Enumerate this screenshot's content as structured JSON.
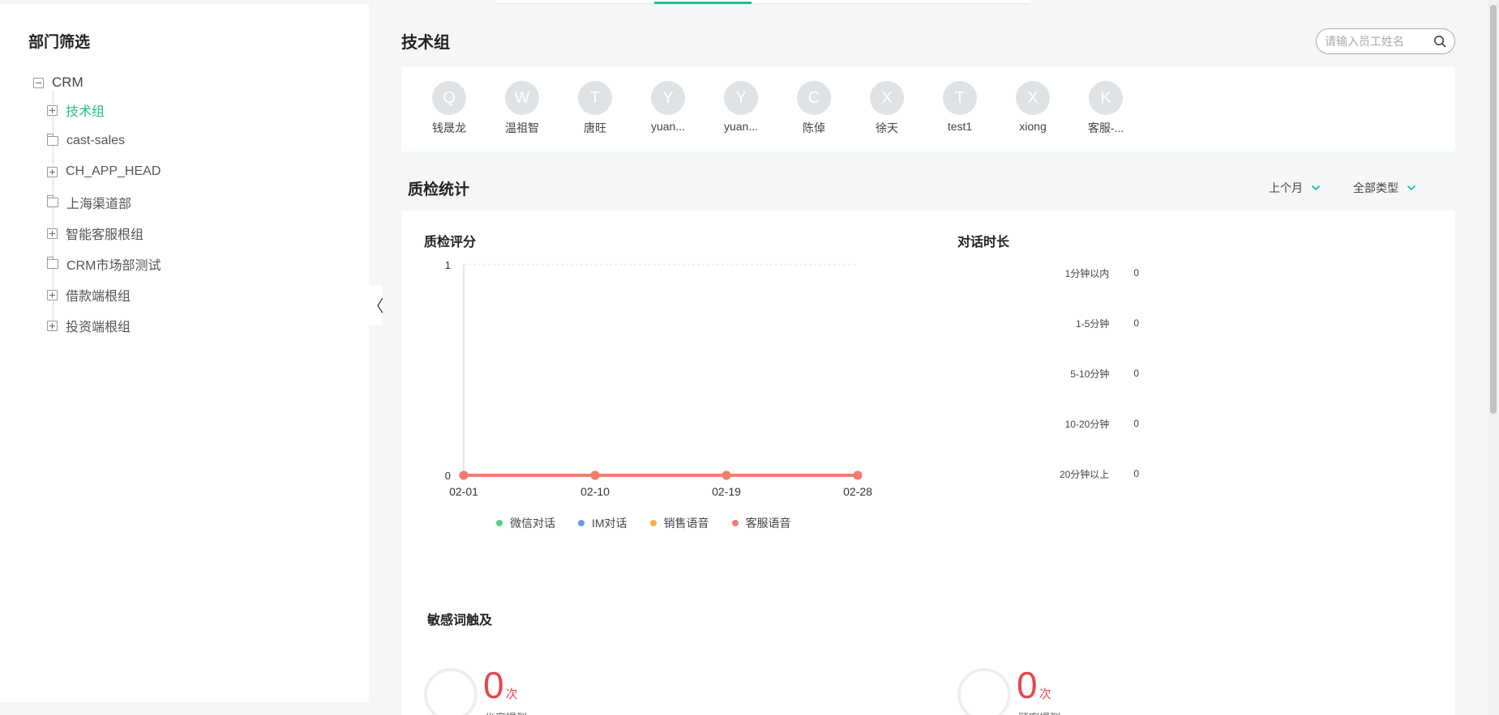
{
  "sidebar": {
    "title": "部门筛选",
    "root": "CRM",
    "items": [
      {
        "label": "技术组",
        "kind": "group",
        "active": true
      },
      {
        "label": "cast-sales",
        "kind": "folder"
      },
      {
        "label": "CH_APP_HEAD",
        "kind": "group"
      },
      {
        "label": "上海渠道部",
        "kind": "folder"
      },
      {
        "label": "智能客服根组",
        "kind": "group"
      },
      {
        "label": "CRM市场部测试",
        "kind": "folder"
      },
      {
        "label": "借款端根组",
        "kind": "group"
      },
      {
        "label": "投资端根组",
        "kind": "group"
      }
    ]
  },
  "collapse_glyph": "〈",
  "header": {
    "title": "技术组",
    "search_placeholder": "请输入员工姓名"
  },
  "members": [
    {
      "initial": "Q",
      "name": "钱晟龙"
    },
    {
      "initial": "W",
      "name": "温祖智"
    },
    {
      "initial": "T",
      "name": "唐旺"
    },
    {
      "initial": "Y",
      "name": "yuan..."
    },
    {
      "initial": "Y",
      "name": "yuan..."
    },
    {
      "initial": "C",
      "name": "陈倬"
    },
    {
      "initial": "X",
      "name": "徐天"
    },
    {
      "initial": "T",
      "name": "test1"
    },
    {
      "initial": "X",
      "name": "xiong"
    },
    {
      "initial": "K",
      "name": "客服-..."
    }
  ],
  "stats": {
    "title": "质检统计",
    "filters": {
      "period": "上个月",
      "type": "全部类型"
    }
  },
  "chart_data": {
    "type": "line",
    "title": "质检评分",
    "x": [
      "02-01",
      "02-10",
      "02-19",
      "02-28"
    ],
    "yticks": [
      0,
      1
    ],
    "ylim": [
      0,
      1
    ],
    "series": [
      {
        "name": "微信对话",
        "color": "#5ad08f",
        "values": [
          0,
          0,
          0,
          0
        ]
      },
      {
        "name": "IM对话",
        "color": "#6b9ce8",
        "values": [
          0,
          0,
          0,
          0
        ]
      },
      {
        "name": "销售语音",
        "color": "#f5b04b",
        "values": [
          0,
          0,
          0,
          0
        ]
      },
      {
        "name": "客服语音",
        "color": "#f37c71",
        "values": [
          0,
          0,
          0,
          0
        ]
      }
    ]
  },
  "duration": {
    "title": "对话时长",
    "rows": [
      {
        "label": "1分钟以内",
        "value": "0"
      },
      {
        "label": "1-5分钟",
        "value": "0"
      },
      {
        "label": "5-10分钟",
        "value": "0"
      },
      {
        "label": "10-20分钟",
        "value": "0"
      },
      {
        "label": "20分钟以上",
        "value": "0"
      }
    ]
  },
  "sensitive": {
    "title": "敏感词触及",
    "items": [
      {
        "count": "0",
        "unit": "次",
        "caption": "坐席提到"
      },
      {
        "count": "0",
        "unit": "次",
        "caption": "顾客提到"
      }
    ]
  },
  "colors": {
    "accent": "#1fc08e",
    "danger": "#e8474e"
  }
}
